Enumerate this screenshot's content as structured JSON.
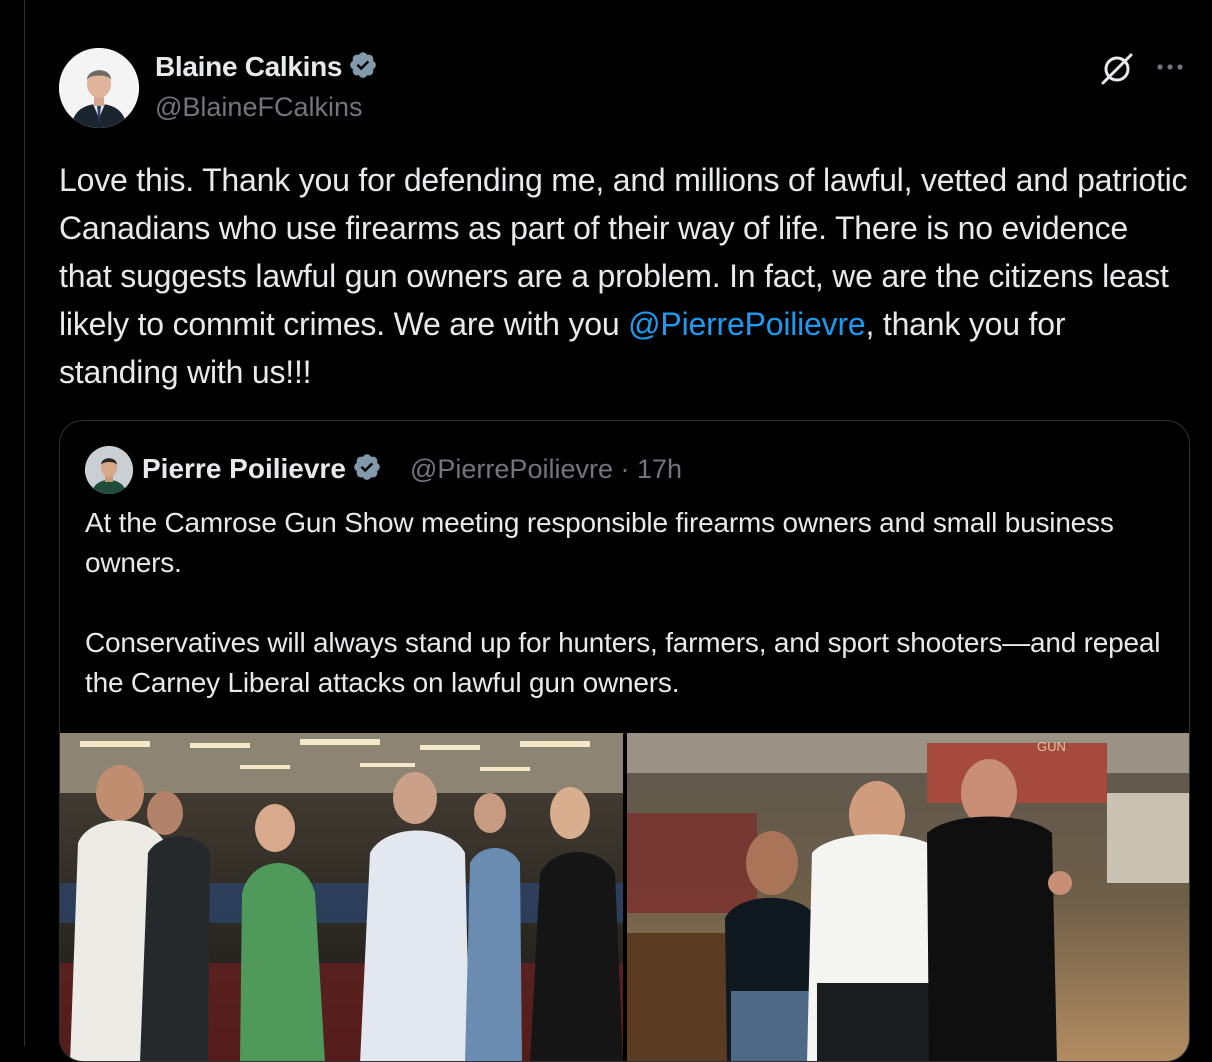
{
  "tweet": {
    "author": {
      "name": "Blaine Calkins",
      "handle": "@BlaineFCalkins"
    },
    "text_before_mention": "Love this. Thank you for defending me, and millions of lawful, vetted and patriotic Canadians who use firearms as part of their way of life. There is no evidence that suggests lawful gun owners are a problem. In fact, we are the citizens least likely to commit crimes. We are with you ",
    "mention": "@PierrePoilievre",
    "text_after_mention": ", thank you for standing with us!!!",
    "icons": {
      "grok": "grok-icon",
      "more": "more-icon",
      "verified": "verified-badge-icon"
    }
  },
  "quote": {
    "author": {
      "name": "Pierre Poilievre",
      "handle": "@PierrePoilievre",
      "separator": "·",
      "time": "17h"
    },
    "paragraphs": [
      "At the Camrose Gun Show meeting responsible firearms owners and small business owners.",
      "Conservatives will always stand up for hunters, farmers, and sport shooters—and repeal the Carney Liberal attacks on lawful gun owners."
    ],
    "photo_sign_text": "GUN"
  },
  "colors": {
    "background": "#000000",
    "text": "#e7e9ea",
    "muted": "#71767b",
    "link": "#1d9bf0",
    "border": "#2f3336",
    "verified": "#829aab"
  }
}
